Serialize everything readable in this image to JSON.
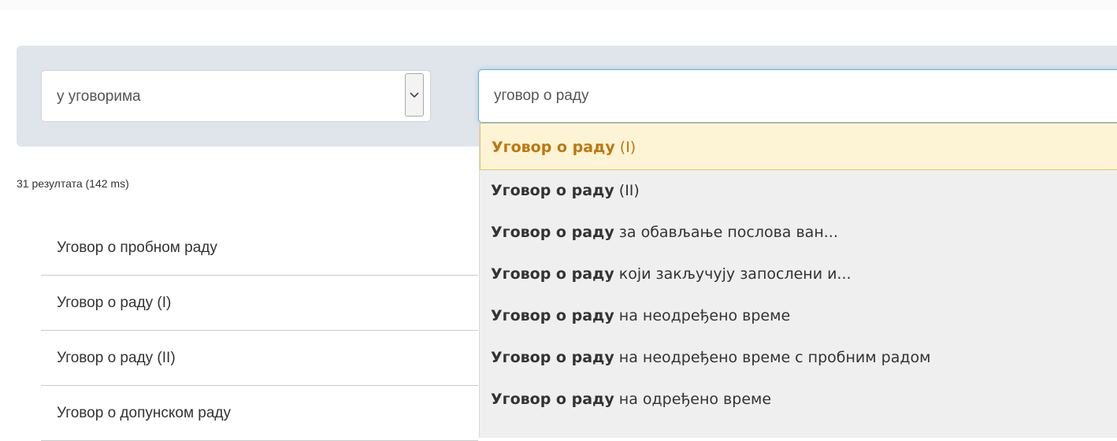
{
  "search": {
    "scope_value": "у уговорима",
    "query_value": "уговор о раду"
  },
  "results": {
    "count_text": "31 резултата (142 ms)",
    "items": [
      "Уговор о пробном раду",
      "Уговор о раду (I)",
      "Уговор о раду (II)",
      "Уговор о допунском раду"
    ]
  },
  "autocomplete": {
    "suggestions": [
      {
        "match": "Уговор о раду",
        "rest": " (I)"
      },
      {
        "match": "Уговор о раду",
        "rest": " (II)"
      },
      {
        "match": "Уговор о раду",
        "rest": " за обављање послова ван..."
      },
      {
        "match": "Уговор о раду",
        "rest": " који закључују запослени и..."
      },
      {
        "match": "Уговор о раду",
        "rest": " на неодређено време"
      },
      {
        "match": "Уговор о раду",
        "rest": " на неодређено време с пробним радом"
      },
      {
        "match": "Уговор о раду",
        "rest": " на одређено време"
      }
    ]
  },
  "colors": {
    "panel_bg": "#dfe5ea",
    "input_focus_border": "#66afe9",
    "active_suggestion_bg": "#fcf4d4",
    "active_suggestion_text": "#c0760f",
    "dropdown_bg": "#efefef"
  },
  "icons": {
    "select_arrow": "chevron-down-icon"
  }
}
